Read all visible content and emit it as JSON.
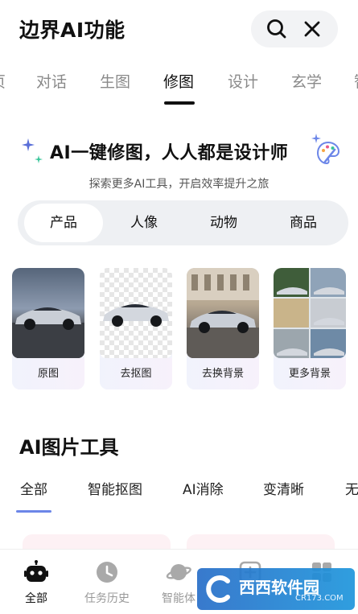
{
  "header": {
    "title": "边界AI功能",
    "search_icon": "search-icon",
    "close_icon": "close-icon"
  },
  "tabs": [
    {
      "label": "页",
      "active": false
    },
    {
      "label": "对话",
      "active": false
    },
    {
      "label": "生图",
      "active": false
    },
    {
      "label": "修图",
      "active": true
    },
    {
      "label": "设计",
      "active": false
    },
    {
      "label": "玄学",
      "active": false
    },
    {
      "label": "智",
      "active": false
    }
  ],
  "hero": {
    "title": "AI一键修图，人人都是设计师",
    "subtitle": "探索更多AI工具，开启效率提升之旅",
    "icon": "palette-icon"
  },
  "segments": [
    {
      "label": "产品",
      "active": true
    },
    {
      "label": "人像",
      "active": false
    },
    {
      "label": "动物",
      "active": false
    },
    {
      "label": "商品",
      "active": false
    }
  ],
  "cards": [
    {
      "label": "原图"
    },
    {
      "label": "去抠图"
    },
    {
      "label": "去换背景"
    },
    {
      "label": "更多背景"
    }
  ],
  "tools": {
    "title": "AI图片工具",
    "subtabs": [
      {
        "label": "全部",
        "active": true
      },
      {
        "label": "智能抠图",
        "active": false
      },
      {
        "label": "AI消除",
        "active": false
      },
      {
        "label": "变清晰",
        "active": false
      },
      {
        "label": "无",
        "active": false
      }
    ]
  },
  "bottom_nav": [
    {
      "label": "全部",
      "icon": "robot-icon",
      "active": true
    },
    {
      "label": "任务历史",
      "icon": "clock-icon",
      "active": false
    },
    {
      "label": "智能体",
      "icon": "planet-icon",
      "active": false
    },
    {
      "label": "",
      "icon": "add-icon",
      "active": false
    },
    {
      "label": "",
      "icon": "grid-icon",
      "active": false
    }
  ],
  "watermark": {
    "text": "西西软件园",
    "sub": "CR173.COM"
  },
  "colors": {
    "accent": "#6c86e8",
    "segment_bg": "#eef0f3",
    "card_label_bg": "#f1f3fc"
  }
}
